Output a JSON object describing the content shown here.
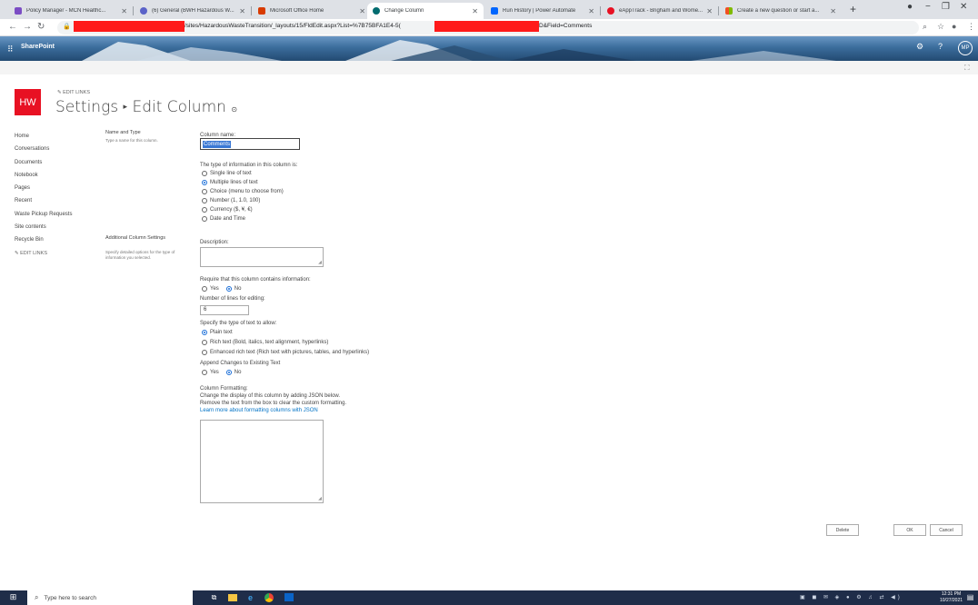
{
  "browser": {
    "tabs": [
      {
        "label": "Policy Manager - MCN Healthc...",
        "color": "#7b4dc4"
      },
      {
        "label": "(6) General (BWH Hazardous W...",
        "color": "#5a62c8"
      },
      {
        "label": "Microsoft Office Home",
        "color": "#d83b01"
      },
      {
        "label": "Change Column",
        "color": "#036c70"
      },
      {
        "label": "Run History | Power Automate",
        "color": "#0066ff"
      },
      {
        "label": "eAppTrack - Brigham and Wome...",
        "color": "#e81123"
      },
      {
        "label": "Create a new question or start a...",
        "color": "#f25022"
      }
    ],
    "url_part1": "/sites/HazardousWasteTransition/_layouts/15/FldEdit.aspx?List=%7B75BFA1E4-5(",
    "url_part2": "D&Field=Comments"
  },
  "suite": {
    "brand": "SharePoint",
    "user_initials": "MP"
  },
  "site": {
    "logo_text": "HW",
    "edit_links": "EDIT LINKS",
    "title_prefix": "Settings",
    "title_separator": "▸",
    "title_main": "Edit Column"
  },
  "nav": {
    "items": [
      "Home",
      "Conversations",
      "Documents",
      "Notebook",
      "Pages",
      "Recent",
      "Waste Pickup Requests",
      "Site contents",
      "Recycle Bin"
    ],
    "edit_links": "EDIT LINKS"
  },
  "sections": {
    "name_type_title": "Name and Type",
    "name_type_desc": "Type a name for this column.",
    "additional_title": "Additional Column Settings",
    "additional_desc": "Specify detailed options for the type of information you selected."
  },
  "form": {
    "column_name_label": "Column name:",
    "column_name_value": "Comments",
    "type_label": "The type of information in this column is:",
    "type_options": [
      {
        "label": "Single line of text",
        "selected": false
      },
      {
        "label": "Multiple lines of text",
        "selected": true
      },
      {
        "label": "Choice (menu to choose from)",
        "selected": false
      },
      {
        "label": "Number (1, 1.0, 100)",
        "selected": false
      },
      {
        "label": "Currency ($, ¥, €)",
        "selected": false
      },
      {
        "label": "Date and Time",
        "selected": false
      }
    ],
    "description_label": "Description:",
    "require_label": "Require that this column contains information:",
    "yes": "Yes",
    "no": "No",
    "lines_label": "Number of lines for editing:",
    "lines_value": "6",
    "text_type_label": "Specify the type of text to allow:",
    "text_type_options": [
      {
        "label": "Plain text",
        "selected": true
      },
      {
        "label": "Rich text (Bold, italics, text alignment, hyperlinks)",
        "selected": false
      },
      {
        "label": "Enhanced rich text (Rich text with pictures, tables, and hyperlinks)",
        "selected": false
      }
    ],
    "append_label": "Append Changes to Existing Text",
    "formatting_label": "Column Formatting:",
    "formatting_line1": "Change the display of this column by adding JSON below.",
    "formatting_line2": "Remove the text from the box to clear the custom formatting.",
    "formatting_link": "Learn more about formatting columns with JSON"
  },
  "buttons": {
    "delete": "Delete",
    "ok": "OK",
    "cancel": "Cancel"
  },
  "taskbar": {
    "search_placeholder": "Type here to search",
    "time": "12:31 PM",
    "date": "10/27/2021"
  }
}
